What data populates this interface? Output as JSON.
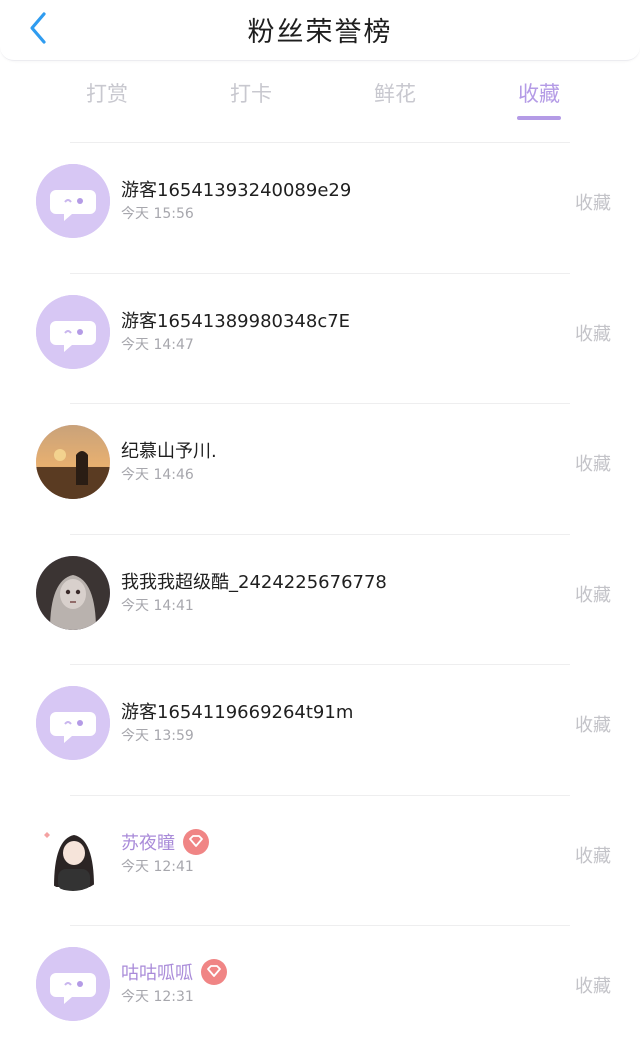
{
  "header": {
    "title": "粉丝荣誉榜",
    "back_icon": "chevron-left-icon"
  },
  "tabs": [
    {
      "label": "打赏",
      "active": false
    },
    {
      "label": "打卡",
      "active": false
    },
    {
      "label": "鲜花",
      "active": false
    },
    {
      "label": "收藏",
      "active": true
    }
  ],
  "accent_color": "#b49be6",
  "list": [
    {
      "name": "游客16541393240089e29",
      "time": "今天 15:56",
      "action": "收藏",
      "avatar": "default-chat-avatar",
      "vip": false
    },
    {
      "name": "游客16541389980348c7E",
      "time": "今天 14:47",
      "action": "收藏",
      "avatar": "default-chat-avatar",
      "vip": false
    },
    {
      "name": "纪慕山予川.",
      "time": "今天 14:46",
      "action": "收藏",
      "avatar": "sunset-photo-avatar",
      "vip": false
    },
    {
      "name": "我我我超级酷_2424225676778",
      "time": "今天 14:41",
      "action": "收藏",
      "avatar": "anime-girl-avatar",
      "vip": false
    },
    {
      "name": "游客1654119669264t91m",
      "time": "今天 13:59",
      "action": "收藏",
      "avatar": "default-chat-avatar",
      "vip": false
    },
    {
      "name": "苏夜瞳",
      "time": "今天 12:41",
      "action": "收藏",
      "avatar": "chibi-girl-avatar",
      "vip": true
    },
    {
      "name": "咕咕呱呱",
      "time": "今天 12:31",
      "action": "收藏",
      "avatar": "default-chat-avatar",
      "vip": true
    }
  ]
}
